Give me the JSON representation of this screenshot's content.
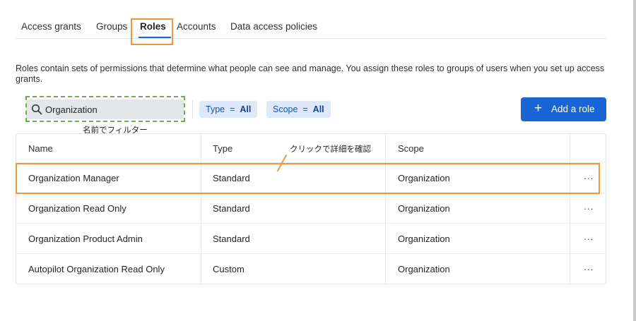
{
  "tabs": [
    {
      "label": "Access grants"
    },
    {
      "label": "Groups"
    },
    {
      "label": "Roles"
    },
    {
      "label": "Accounts"
    },
    {
      "label": "Data access policies"
    }
  ],
  "active_tab": "Roles",
  "description": "Roles contain sets of permissions that determine what people can see and manage. You assign these roles to groups of users when you set up access grants.",
  "search": {
    "value": "Organization"
  },
  "filters": {
    "type": {
      "label": "Type",
      "op": "=",
      "value": "All"
    },
    "scope": {
      "label": "Scope",
      "op": "=",
      "value": "All"
    }
  },
  "add_button": {
    "label": "Add a role",
    "icon": "plus-icon"
  },
  "annotations": {
    "filter_note": "名前でフィルター",
    "click_note": "クリックで詳細を確認"
  },
  "table": {
    "headers": {
      "name": "Name",
      "type": "Type",
      "scope": "Scope"
    },
    "rows": [
      {
        "name": "Organization Manager",
        "type": "Standard",
        "scope": "Organization",
        "menu": "···"
      },
      {
        "name": "Organization Read Only",
        "type": "Standard",
        "scope": "Organization",
        "menu": "···"
      },
      {
        "name": "Organization Product Admin",
        "type": "Standard",
        "scope": "Organization",
        "menu": "···"
      },
      {
        "name": "Autopilot Organization Read Only",
        "type": "Custom",
        "scope": "Organization",
        "menu": "···"
      }
    ]
  },
  "colors": {
    "accent": "#1a65d6",
    "callout": "#f0963c",
    "dashed": "#6ab04c"
  }
}
